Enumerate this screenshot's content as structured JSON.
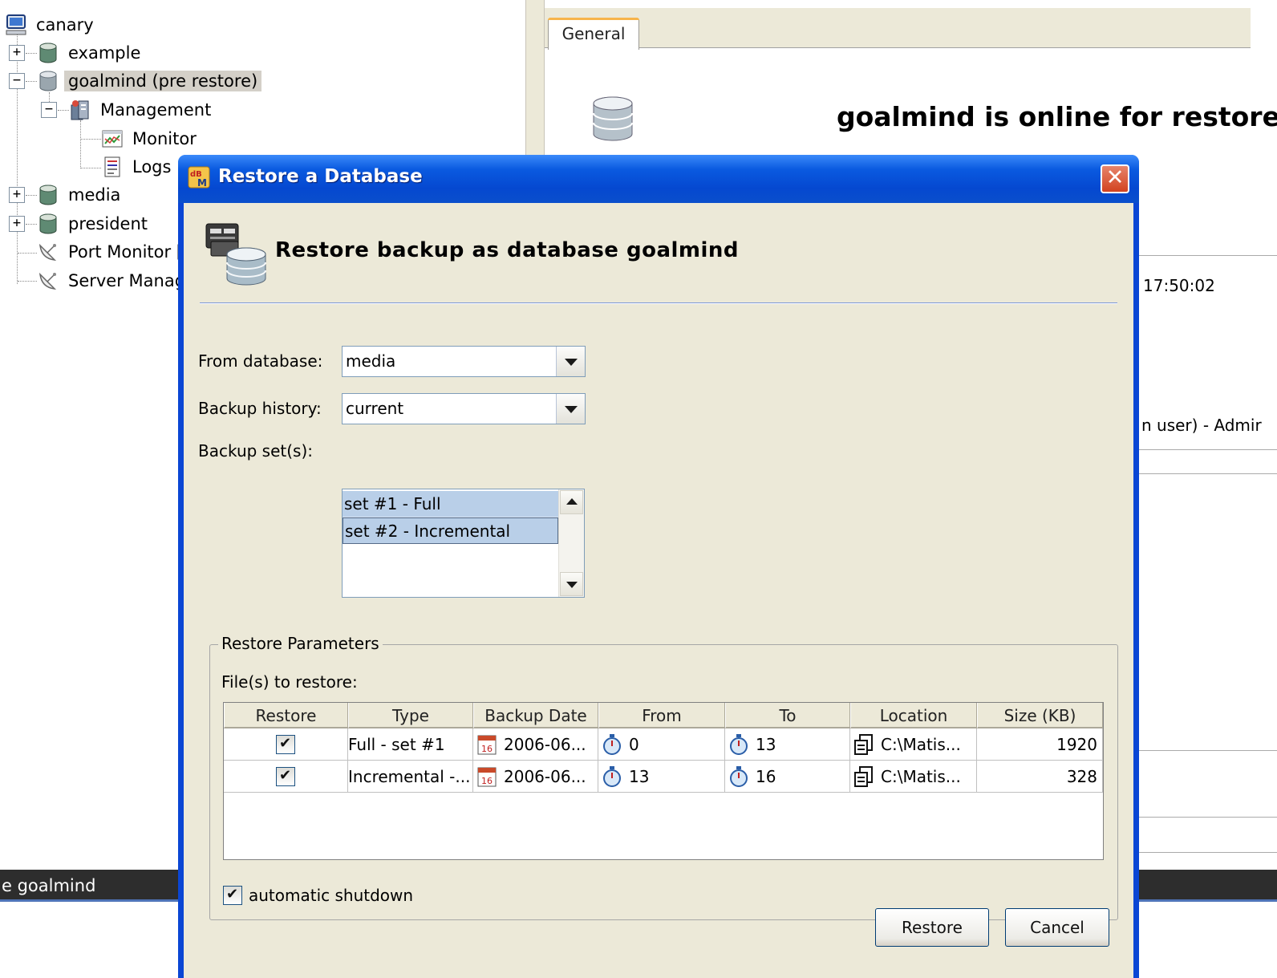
{
  "tree": {
    "root": "canary",
    "items": [
      {
        "label": "example"
      },
      {
        "label": "goalmind (pre restore)"
      },
      {
        "label": "Management"
      },
      {
        "label": "Monitor"
      },
      {
        "label": "Logs"
      },
      {
        "label": "media"
      },
      {
        "label": "president"
      },
      {
        "label": "Port Monitor [t"
      },
      {
        "label": "Server Manag"
      }
    ]
  },
  "right_panel": {
    "tab_general": "General",
    "online_message": "goalmind is online for restore",
    "time_text": "17:50:02",
    "user_text": "n user) - Admir"
  },
  "statusbar": {
    "text": "e goalmind"
  },
  "dialog": {
    "title": "Restore a Database",
    "close": "✕",
    "header": "Restore backup as database goalmind",
    "from_database_label": "From database:",
    "from_database_value": "media",
    "backup_history_label": "Backup history:",
    "backup_history_value": "current",
    "backup_sets_label": "Backup set(s):",
    "backup_sets": [
      "set #1  - Full",
      "set #2 - Incremental"
    ],
    "params_group": "Restore Parameters",
    "files_label": "File(s) to restore:",
    "table": {
      "headers": [
        "Restore",
        "Type",
        "Backup Date",
        "From",
        "To",
        "Location",
        "Size (KB)"
      ],
      "rows": [
        {
          "restore": true,
          "type": "Full - set #1",
          "date": "2006-06...",
          "from": "0",
          "to": "13",
          "location": "C:\\Matis...",
          "size": "1920"
        },
        {
          "restore": true,
          "type": "Incremental -...",
          "date": "2006-06...",
          "from": "13",
          "to": "16",
          "location": "C:\\Matis...",
          "size": "328"
        }
      ]
    },
    "auto_shutdown_label": "automatic shutdown",
    "auto_shutdown_checked": true,
    "restore_button": "Restore",
    "cancel_button": "Cancel"
  }
}
